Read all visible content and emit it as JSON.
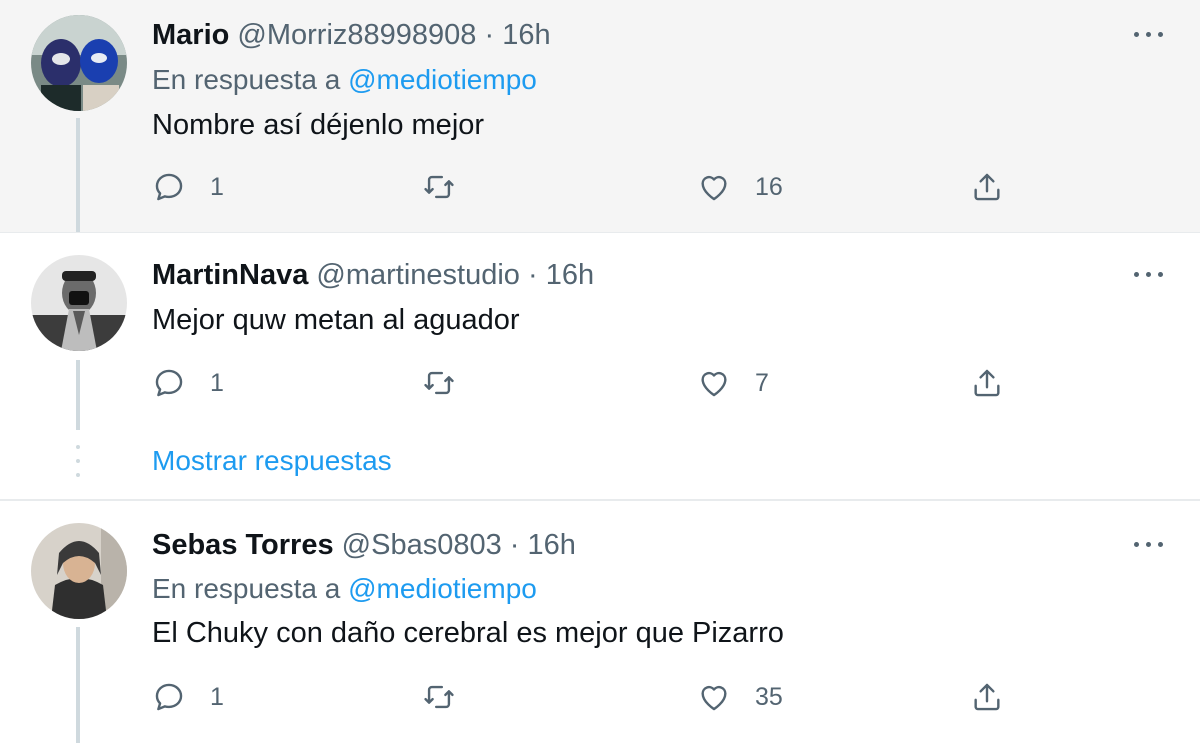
{
  "tweets": [
    {
      "name": "Mario",
      "handle": "@Morriz88998908",
      "separator": "·",
      "time": "16h",
      "reply_prefix": "En respuesta a",
      "reply_to": "@mediotiempo",
      "text": "Nombre así déjenlo mejor",
      "replies": "1",
      "retweets": "",
      "likes": "16"
    },
    {
      "name": "MartinNava",
      "handle": "@martinestudio",
      "separator": "·",
      "time": "16h",
      "text": "Mejor quw metan al aguador",
      "replies": "1",
      "retweets": "",
      "likes": "7"
    },
    {
      "name": "Sebas Torres",
      "handle": "@Sbas0803",
      "separator": "·",
      "time": "16h",
      "reply_prefix": "En respuesta a",
      "reply_to": "@mediotiempo",
      "text": "El Chuky con daño cerebral es mejor que Pizarro",
      "replies": "1",
      "retweets": "",
      "likes": "35"
    }
  ],
  "show_replies_label": "Mostrar respuestas",
  "icons": {
    "reply": "reply-icon",
    "retweet": "retweet-icon",
    "like": "heart-icon",
    "share": "share-icon",
    "more": "more-options-icon"
  },
  "colors": {
    "accent": "#1d9bf0",
    "secondary_text": "#536471",
    "highlight_bg": "#f5f5f5"
  }
}
